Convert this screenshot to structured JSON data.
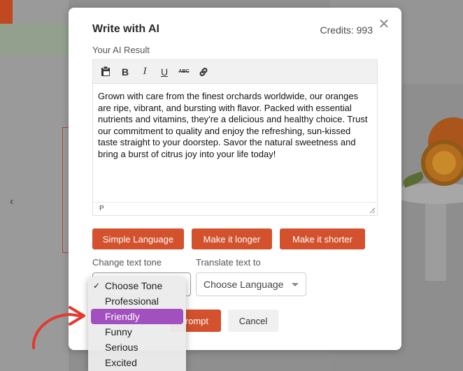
{
  "modal": {
    "title": "Write with AI",
    "credits": "Credits: 993",
    "close_icon": "close-icon",
    "result_label": "Your AI Result"
  },
  "editor": {
    "toolbar_icons": [
      "clipboard-paste-icon",
      "bold-icon",
      "italic-icon",
      "underline-icon",
      "strikethrough-icon",
      "link-icon"
    ],
    "bold_glyph": "B",
    "italic_glyph": "I",
    "underline_glyph": "U",
    "strike_glyph": "ABC",
    "content": "Grown with care from the finest orchards worldwide, our oranges are ripe, vibrant, and bursting with flavor. Packed with essential nutrients and vitamins, they're a delicious and healthy choice. Trust our commitment to quality and enjoy the refreshing, sun-kissed taste straight to your doorstep. Savor the natural sweetness and bring a burst of citrus joy into your life today!",
    "status_path": "P"
  },
  "actions": {
    "simple": "Simple Language",
    "longer": "Make it longer",
    "shorter": "Make it shorter"
  },
  "tone": {
    "label": "Change text tone",
    "options": [
      "Choose Tone",
      "Professional",
      "Friendly",
      "Funny",
      "Serious",
      "Excited"
    ],
    "checked": "Choose Tone",
    "highlighted": "Friendly",
    "check_mark": "✓"
  },
  "translate": {
    "label": "Translate text to",
    "selected": "Choose Language"
  },
  "footer": {
    "prompt_button": "rompt",
    "cancel_button": "Cancel"
  },
  "colors": {
    "accent": "#d3512d",
    "highlight": "#a24fbf",
    "annotation_arrow": "#e23a2e"
  }
}
